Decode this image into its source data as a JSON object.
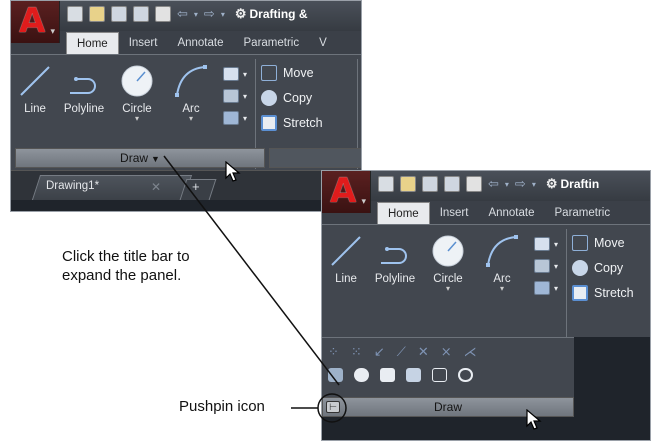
{
  "app_logo_letter": "A",
  "workspace_label": "Drafting &",
  "workspace_label_2": "Draftin",
  "tabs": [
    "Home",
    "Insert",
    "Annotate",
    "Parametric",
    "V"
  ],
  "tabs_2": [
    "Home",
    "Insert",
    "Annotate",
    "Parametric"
  ],
  "draw_tools": {
    "line": "Line",
    "polyline": "Polyline",
    "circle": "Circle",
    "arc": "Arc"
  },
  "modify_tools": {
    "move": "Move",
    "copy": "Copy",
    "stretch": "Stretch",
    "stretch_2": "Stretch"
  },
  "draw_panel_title": "Draw",
  "document_tab": "Drawing1*",
  "annotations": {
    "expand_hint": "Click the title bar to\nexpand the panel.",
    "pushpin_label": "Pushpin icon"
  },
  "colors": {
    "ribbon_bg": "#42474f",
    "accent_red": "#e01c1c",
    "panel_bar": "#8e949c"
  }
}
